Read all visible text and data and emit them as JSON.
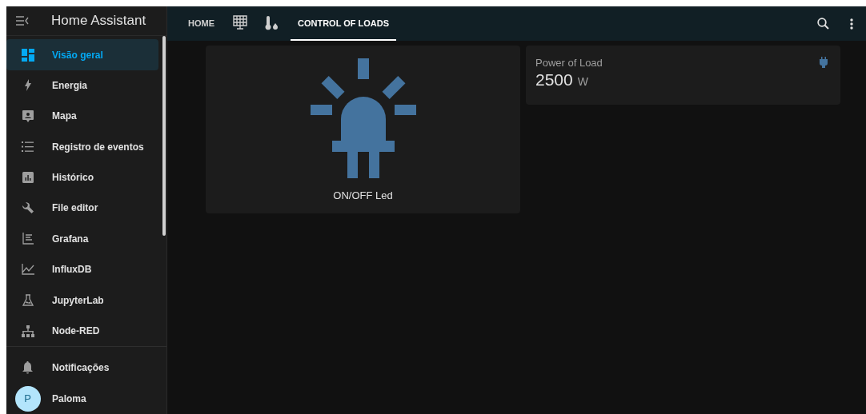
{
  "app_title": "Home Assistant",
  "sidebar": {
    "items": [
      {
        "label": "Visão geral",
        "selected": true
      },
      {
        "label": "Energia",
        "selected": false
      },
      {
        "label": "Mapa",
        "selected": false
      },
      {
        "label": "Registro de eventos",
        "selected": false
      },
      {
        "label": "Histórico",
        "selected": false
      },
      {
        "label": "File editor",
        "selected": false
      },
      {
        "label": "Grafana",
        "selected": false
      },
      {
        "label": "InfluxDB",
        "selected": false
      },
      {
        "label": "JupyterLab",
        "selected": false
      },
      {
        "label": "Node-RED",
        "selected": false
      }
    ],
    "notifications": {
      "label": "Notificações"
    },
    "user": {
      "initial": "P",
      "name": "Paloma"
    }
  },
  "tabs": [
    {
      "kind": "text",
      "label": "HOME",
      "selected": false
    },
    {
      "kind": "icon",
      "selected": false
    },
    {
      "kind": "icon",
      "selected": false
    },
    {
      "kind": "text",
      "label": "CONTROL OF LOADS",
      "selected": true
    }
  ],
  "cards": [
    {
      "kind": "button",
      "name": "ON/OFF Led"
    },
    {
      "kind": "sensor",
      "name": "Power of Load",
      "value": "2500",
      "unit": "W"
    }
  ]
}
